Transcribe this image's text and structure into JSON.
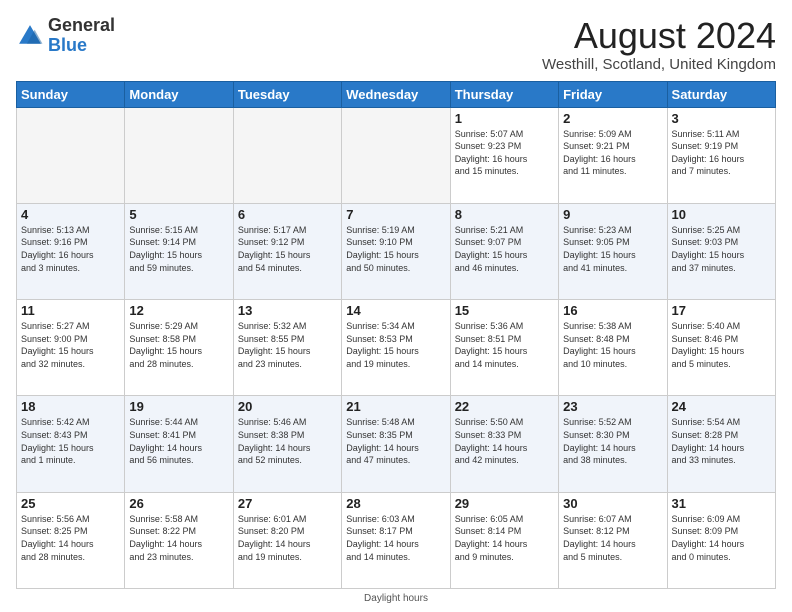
{
  "logo": {
    "general": "General",
    "blue": "Blue"
  },
  "title": "August 2024",
  "subtitle": "Westhill, Scotland, United Kingdom",
  "days_header": [
    "Sunday",
    "Monday",
    "Tuesday",
    "Wednesday",
    "Thursday",
    "Friday",
    "Saturday"
  ],
  "footer_label": "Daylight hours",
  "weeks": [
    [
      {
        "day": "",
        "info": ""
      },
      {
        "day": "",
        "info": ""
      },
      {
        "day": "",
        "info": ""
      },
      {
        "day": "",
        "info": ""
      },
      {
        "day": "1",
        "info": "Sunrise: 5:07 AM\nSunset: 9:23 PM\nDaylight: 16 hours\nand 15 minutes."
      },
      {
        "day": "2",
        "info": "Sunrise: 5:09 AM\nSunset: 9:21 PM\nDaylight: 16 hours\nand 11 minutes."
      },
      {
        "day": "3",
        "info": "Sunrise: 5:11 AM\nSunset: 9:19 PM\nDaylight: 16 hours\nand 7 minutes."
      }
    ],
    [
      {
        "day": "4",
        "info": "Sunrise: 5:13 AM\nSunset: 9:16 PM\nDaylight: 16 hours\nand 3 minutes."
      },
      {
        "day": "5",
        "info": "Sunrise: 5:15 AM\nSunset: 9:14 PM\nDaylight: 15 hours\nand 59 minutes."
      },
      {
        "day": "6",
        "info": "Sunrise: 5:17 AM\nSunset: 9:12 PM\nDaylight: 15 hours\nand 54 minutes."
      },
      {
        "day": "7",
        "info": "Sunrise: 5:19 AM\nSunset: 9:10 PM\nDaylight: 15 hours\nand 50 minutes."
      },
      {
        "day": "8",
        "info": "Sunrise: 5:21 AM\nSunset: 9:07 PM\nDaylight: 15 hours\nand 46 minutes."
      },
      {
        "day": "9",
        "info": "Sunrise: 5:23 AM\nSunset: 9:05 PM\nDaylight: 15 hours\nand 41 minutes."
      },
      {
        "day": "10",
        "info": "Sunrise: 5:25 AM\nSunset: 9:03 PM\nDaylight: 15 hours\nand 37 minutes."
      }
    ],
    [
      {
        "day": "11",
        "info": "Sunrise: 5:27 AM\nSunset: 9:00 PM\nDaylight: 15 hours\nand 32 minutes."
      },
      {
        "day": "12",
        "info": "Sunrise: 5:29 AM\nSunset: 8:58 PM\nDaylight: 15 hours\nand 28 minutes."
      },
      {
        "day": "13",
        "info": "Sunrise: 5:32 AM\nSunset: 8:55 PM\nDaylight: 15 hours\nand 23 minutes."
      },
      {
        "day": "14",
        "info": "Sunrise: 5:34 AM\nSunset: 8:53 PM\nDaylight: 15 hours\nand 19 minutes."
      },
      {
        "day": "15",
        "info": "Sunrise: 5:36 AM\nSunset: 8:51 PM\nDaylight: 15 hours\nand 14 minutes."
      },
      {
        "day": "16",
        "info": "Sunrise: 5:38 AM\nSunset: 8:48 PM\nDaylight: 15 hours\nand 10 minutes."
      },
      {
        "day": "17",
        "info": "Sunrise: 5:40 AM\nSunset: 8:46 PM\nDaylight: 15 hours\nand 5 minutes."
      }
    ],
    [
      {
        "day": "18",
        "info": "Sunrise: 5:42 AM\nSunset: 8:43 PM\nDaylight: 15 hours\nand 1 minute."
      },
      {
        "day": "19",
        "info": "Sunrise: 5:44 AM\nSunset: 8:41 PM\nDaylight: 14 hours\nand 56 minutes."
      },
      {
        "day": "20",
        "info": "Sunrise: 5:46 AM\nSunset: 8:38 PM\nDaylight: 14 hours\nand 52 minutes."
      },
      {
        "day": "21",
        "info": "Sunrise: 5:48 AM\nSunset: 8:35 PM\nDaylight: 14 hours\nand 47 minutes."
      },
      {
        "day": "22",
        "info": "Sunrise: 5:50 AM\nSunset: 8:33 PM\nDaylight: 14 hours\nand 42 minutes."
      },
      {
        "day": "23",
        "info": "Sunrise: 5:52 AM\nSunset: 8:30 PM\nDaylight: 14 hours\nand 38 minutes."
      },
      {
        "day": "24",
        "info": "Sunrise: 5:54 AM\nSunset: 8:28 PM\nDaylight: 14 hours\nand 33 minutes."
      }
    ],
    [
      {
        "day": "25",
        "info": "Sunrise: 5:56 AM\nSunset: 8:25 PM\nDaylight: 14 hours\nand 28 minutes."
      },
      {
        "day": "26",
        "info": "Sunrise: 5:58 AM\nSunset: 8:22 PM\nDaylight: 14 hours\nand 23 minutes."
      },
      {
        "day": "27",
        "info": "Sunrise: 6:01 AM\nSunset: 8:20 PM\nDaylight: 14 hours\nand 19 minutes."
      },
      {
        "day": "28",
        "info": "Sunrise: 6:03 AM\nSunset: 8:17 PM\nDaylight: 14 hours\nand 14 minutes."
      },
      {
        "day": "29",
        "info": "Sunrise: 6:05 AM\nSunset: 8:14 PM\nDaylight: 14 hours\nand 9 minutes."
      },
      {
        "day": "30",
        "info": "Sunrise: 6:07 AM\nSunset: 8:12 PM\nDaylight: 14 hours\nand 5 minutes."
      },
      {
        "day": "31",
        "info": "Sunrise: 6:09 AM\nSunset: 8:09 PM\nDaylight: 14 hours\nand 0 minutes."
      }
    ]
  ]
}
